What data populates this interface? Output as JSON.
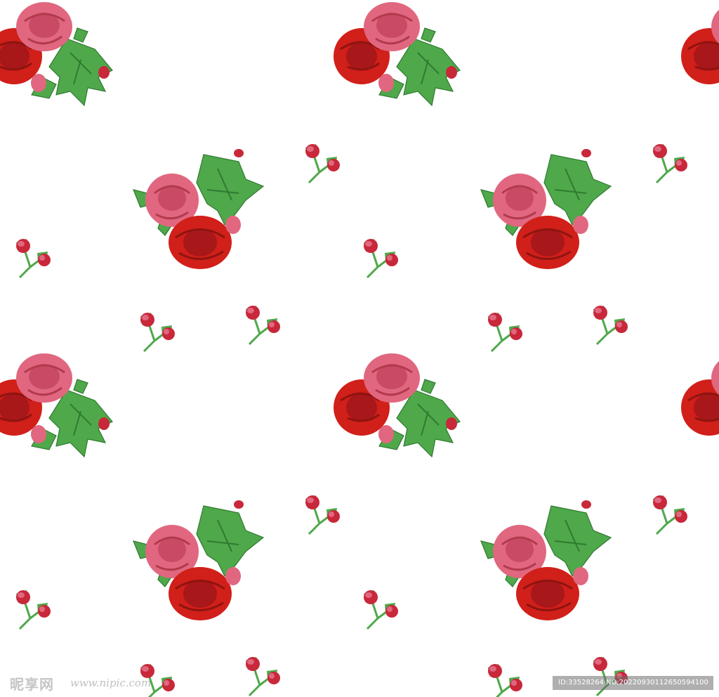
{
  "image": {
    "description_kind": "seamless floral pattern",
    "background_color": "#ffffff",
    "colors": {
      "rose_red": "#d11f1a",
      "rose_red_dark": "#8e1410",
      "rose_pink": "#e0677f",
      "rose_pink_dark": "#b23a4e",
      "leaf_green": "#4fa84a",
      "leaf_green_dark": "#2f7a31",
      "bud_red": "#c8283a"
    },
    "motifs": [
      "large-rose-bouquet",
      "small-rose-bouquet",
      "rosebud-pair"
    ]
  },
  "watermark": {
    "logo_text": "昵享网",
    "url_text": "www.nipic.com",
    "id_text": "ID:33528264 NO:20220930112650594100"
  }
}
